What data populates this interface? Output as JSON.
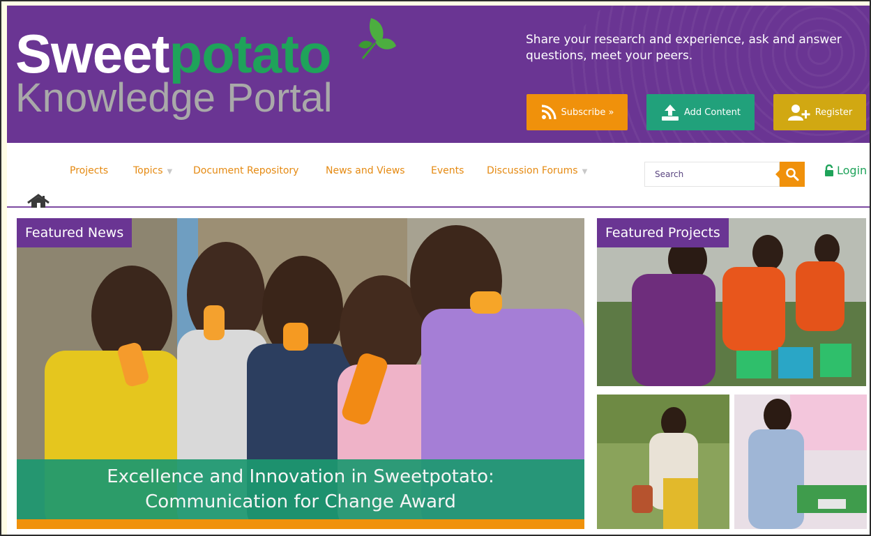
{
  "brand": {
    "name_part1": "Sweet",
    "name_part2": "potato",
    "subtitle": "Knowledge Portal"
  },
  "header": {
    "tagline": "Share your research and experience, ask and answer questions, meet your peers.",
    "subscribe_label": "Subscribe »",
    "add_content_label": "Add Content",
    "register_label": "Register"
  },
  "nav": {
    "items": [
      {
        "label": "Projects",
        "has_dropdown": false
      },
      {
        "label": "Topics",
        "has_dropdown": true
      },
      {
        "label": "Document Repository",
        "has_dropdown": false
      },
      {
        "label": "News and Views",
        "has_dropdown": false
      },
      {
        "label": "Events",
        "has_dropdown": false
      },
      {
        "label": "Discussion Forums",
        "has_dropdown": true
      }
    ],
    "search_placeholder": "Search",
    "login_label": "Login"
  },
  "featured_news": {
    "tag": "Featured News",
    "caption": "Excellence and Innovation in Sweetpotato: Communication for Change Award"
  },
  "featured_projects": {
    "tag": "Featured Projects"
  },
  "icons": {
    "subscribe": "rss-icon",
    "add_content": "upload-icon",
    "register": "add-user-icon",
    "search": "search-icon",
    "login": "lock-icon",
    "home": "home-icon"
  },
  "colors": {
    "header_purple": "#6a3593",
    "brand_green": "#1fa35a",
    "orange": "#f0910b",
    "teal": "#21a17b",
    "gold": "#d1a812"
  }
}
